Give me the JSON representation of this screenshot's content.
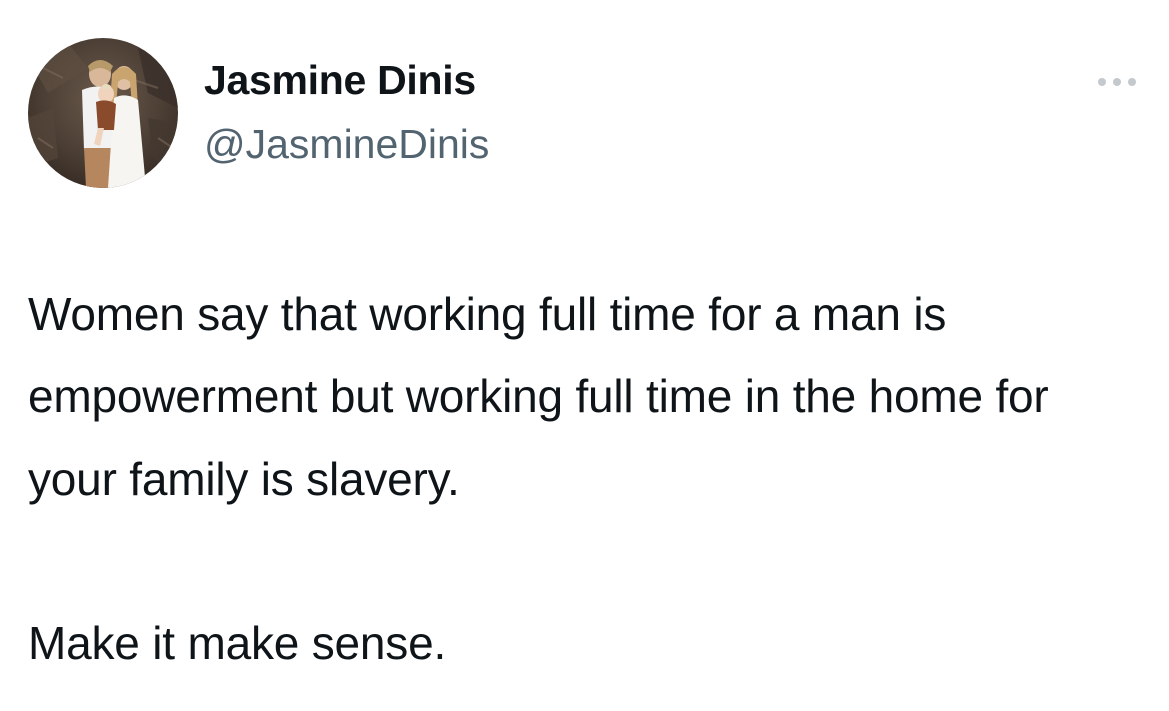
{
  "tweet": {
    "author": {
      "display_name": "Jasmine Dinis",
      "handle": "@JasmineDinis",
      "avatar_icon": "family-photo-avatar"
    },
    "more_icon": "more-options-icon",
    "text": "Women say that working full time for a man is empowerment but working full time in the home for your family is slavery.\n\nMake it make sense."
  },
  "colors": {
    "text": "#0f1419",
    "secondary_text": "#536471",
    "more_icon": "#c4c9ce",
    "background": "#ffffff"
  }
}
